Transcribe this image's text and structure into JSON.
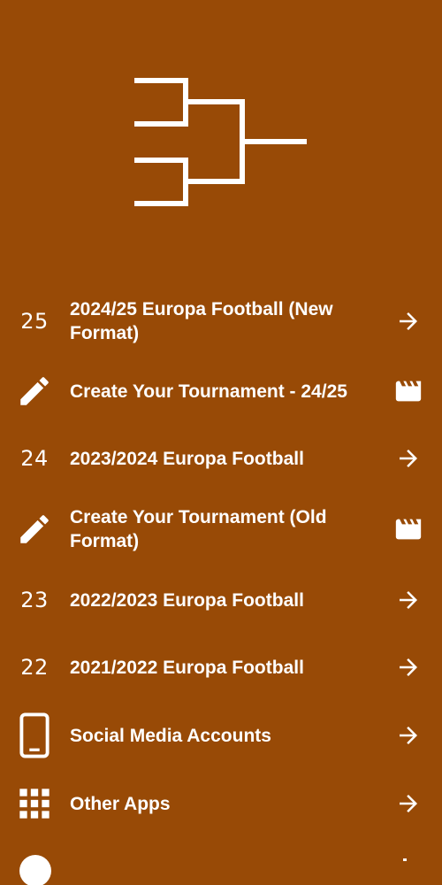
{
  "colors": {
    "background": "#984a06",
    "foreground": "#ffffff"
  },
  "logo": {
    "icon": "tournament-bracket-icon"
  },
  "menu": {
    "items": [
      {
        "lead_text": "25",
        "label": "2024/25 Europa Football (New Format)",
        "trail_icon": "arrow-right-icon"
      },
      {
        "lead_icon": "pencil-icon",
        "label": "Create Your Tournament - 24/25",
        "trail_icon": "clapperboard-icon"
      },
      {
        "lead_text": "24",
        "label": "2023/2024 Europa Football",
        "trail_icon": "arrow-right-icon"
      },
      {
        "lead_icon": "pencil-icon",
        "label": "Create Your Tournament (Old Format)",
        "trail_icon": "clapperboard-icon"
      },
      {
        "lead_text": "23",
        "label": "2022/2023 Europa Football",
        "trail_icon": "arrow-right-icon"
      },
      {
        "lead_text": "22",
        "label": "2021/2022 Europa Football",
        "trail_icon": "arrow-right-icon"
      },
      {
        "lead_icon": "smartphone-icon",
        "label": "Social Media Accounts",
        "trail_icon": "arrow-right-icon"
      },
      {
        "lead_icon": "grid-apps-icon",
        "label": "Other Apps",
        "trail_icon": "arrow-right-icon"
      }
    ]
  }
}
